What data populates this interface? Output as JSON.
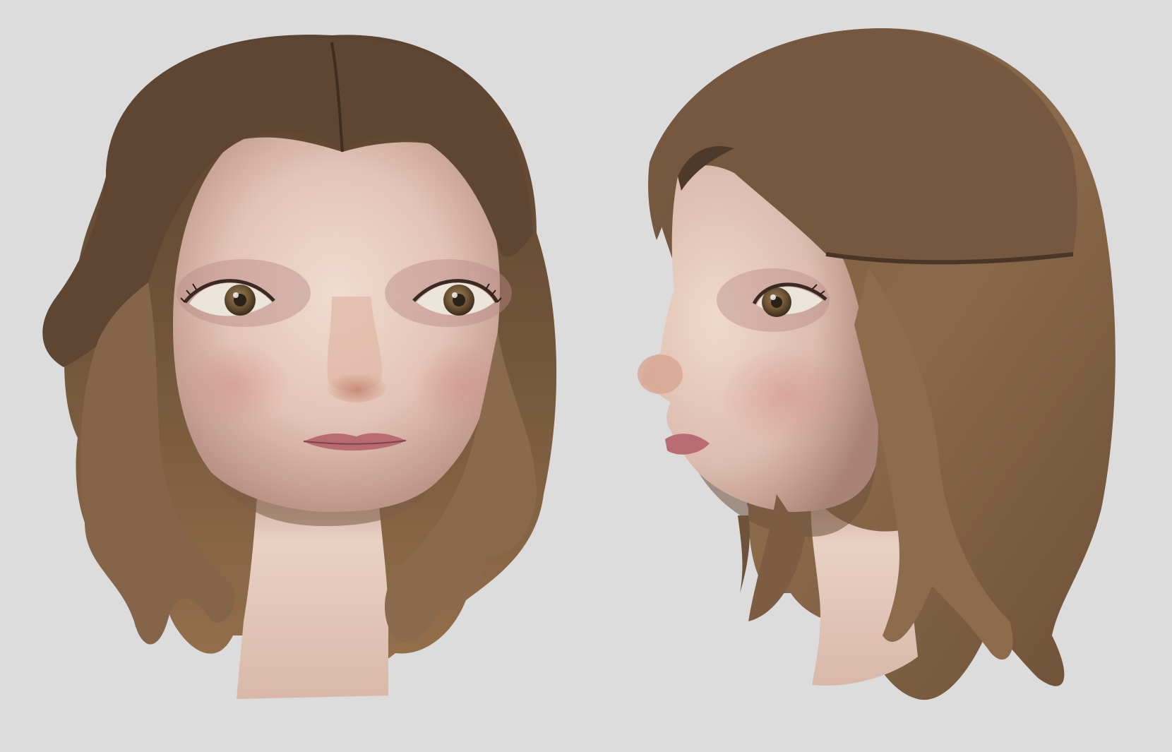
{
  "scene": {
    "background_color": "#dcdcdc",
    "views": [
      {
        "id": "front",
        "name": "front-view"
      },
      {
        "id": "side",
        "name": "side-view"
      }
    ]
  },
  "palette": {
    "hair_dark": "#5a4330",
    "hair_mid": "#7d5e41",
    "hair_light": "#a57f58",
    "skin_light": "#ead2c4",
    "skin_mid": "#d7ae9e",
    "skin_shadow": "#b88f80",
    "blush": "#d69a93",
    "lips": "#b96f72",
    "iris": "#6a5433",
    "pupil": "#2d2218",
    "eye_white": "#ece8dc"
  }
}
